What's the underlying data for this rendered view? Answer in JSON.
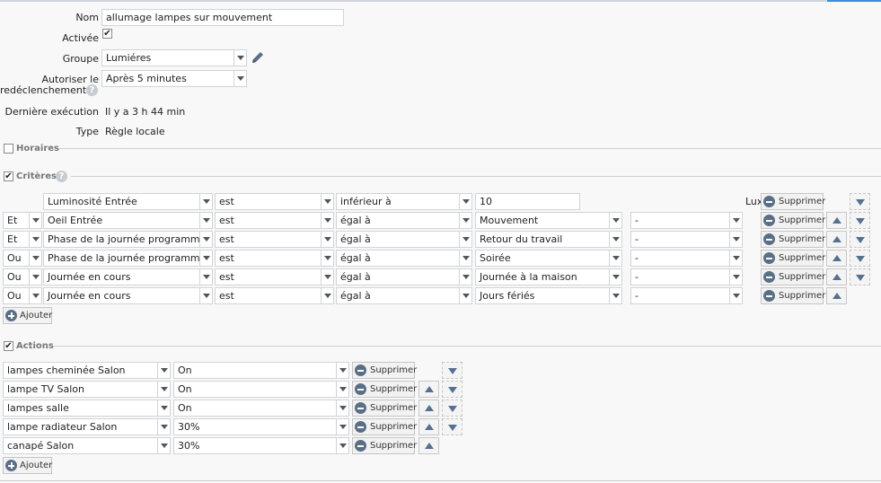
{
  "form": {
    "name_label": "Nom",
    "name_value": "allumage lampes sur mouvement",
    "enabled_label": "Activée",
    "group_label": "Groupe",
    "group_value": "Lumiéres",
    "retrigger_label_1": "Autoriser le",
    "retrigger_label_2": "redéclenchement",
    "retrigger_value": "Après 5 minutes",
    "last_exec_label": "Dernière exécution",
    "last_exec_value": "Il y a 3 h 44 min",
    "type_label": "Type",
    "type_value": "Règle locale"
  },
  "sections": {
    "schedules": "Horaires",
    "criteria": "Critères",
    "actions": "Actions"
  },
  "criteria": [
    {
      "conj": "",
      "device": "Luminosité Entrée",
      "verb": "est",
      "op": "inférieur à",
      "value": "10",
      "value_is_input": true,
      "extra": "",
      "unit": "Lux",
      "delete": "Supprimer",
      "up": false,
      "down": true
    },
    {
      "conj": "Et",
      "device": "Oeil Entrée",
      "verb": "est",
      "op": "égal à",
      "value": "Mouvement",
      "value_is_input": false,
      "extra": "-",
      "unit": "",
      "delete": "Supprimer",
      "up": true,
      "down": true
    },
    {
      "conj": "Et",
      "device": "Phase de la journée programmatio",
      "verb": "est",
      "op": "égal à",
      "value": "Retour du travail",
      "value_is_input": false,
      "extra": "-",
      "unit": "",
      "delete": "Supprimer",
      "up": true,
      "down": true
    },
    {
      "conj": "Ou",
      "device": "Phase de la journée programmatio",
      "verb": "est",
      "op": "égal à",
      "value": "Soirée",
      "value_is_input": false,
      "extra": "-",
      "unit": "",
      "delete": "Supprimer",
      "up": true,
      "down": true
    },
    {
      "conj": "Ou",
      "device": "Journée en cours",
      "verb": "est",
      "op": "égal à",
      "value": "Journée à la maison",
      "value_is_input": false,
      "extra": "-",
      "unit": "",
      "delete": "Supprimer",
      "up": true,
      "down": true
    },
    {
      "conj": "Ou",
      "device": "Journée en cours",
      "verb": "est",
      "op": "égal à",
      "value": "Jours fériés",
      "value_is_input": false,
      "extra": "-",
      "unit": "",
      "delete": "Supprimer",
      "up": true,
      "down": false
    }
  ],
  "criteria_add": "Ajouter",
  "actions": [
    {
      "device": "lampes cheminée Salon",
      "value": "On",
      "delete": "Supprimer",
      "up": false,
      "down": true
    },
    {
      "device": "lampe TV Salon",
      "value": "On",
      "delete": "Supprimer",
      "up": true,
      "down": true
    },
    {
      "device": "lampes salle",
      "value": "On",
      "delete": "Supprimer",
      "up": true,
      "down": true
    },
    {
      "device": "lampe radiateur Salon",
      "value": "30%",
      "delete": "Supprimer",
      "up": true,
      "down": true
    },
    {
      "device": "canapé Salon",
      "value": "30%",
      "delete": "Supprimer",
      "up": true,
      "down": false
    }
  ],
  "actions_add": "Ajouter",
  "help_glyph": "?",
  "check_glyph": "✔",
  "colors": {
    "accent": "#3b8de0",
    "button_icon": "#5a6f86"
  }
}
